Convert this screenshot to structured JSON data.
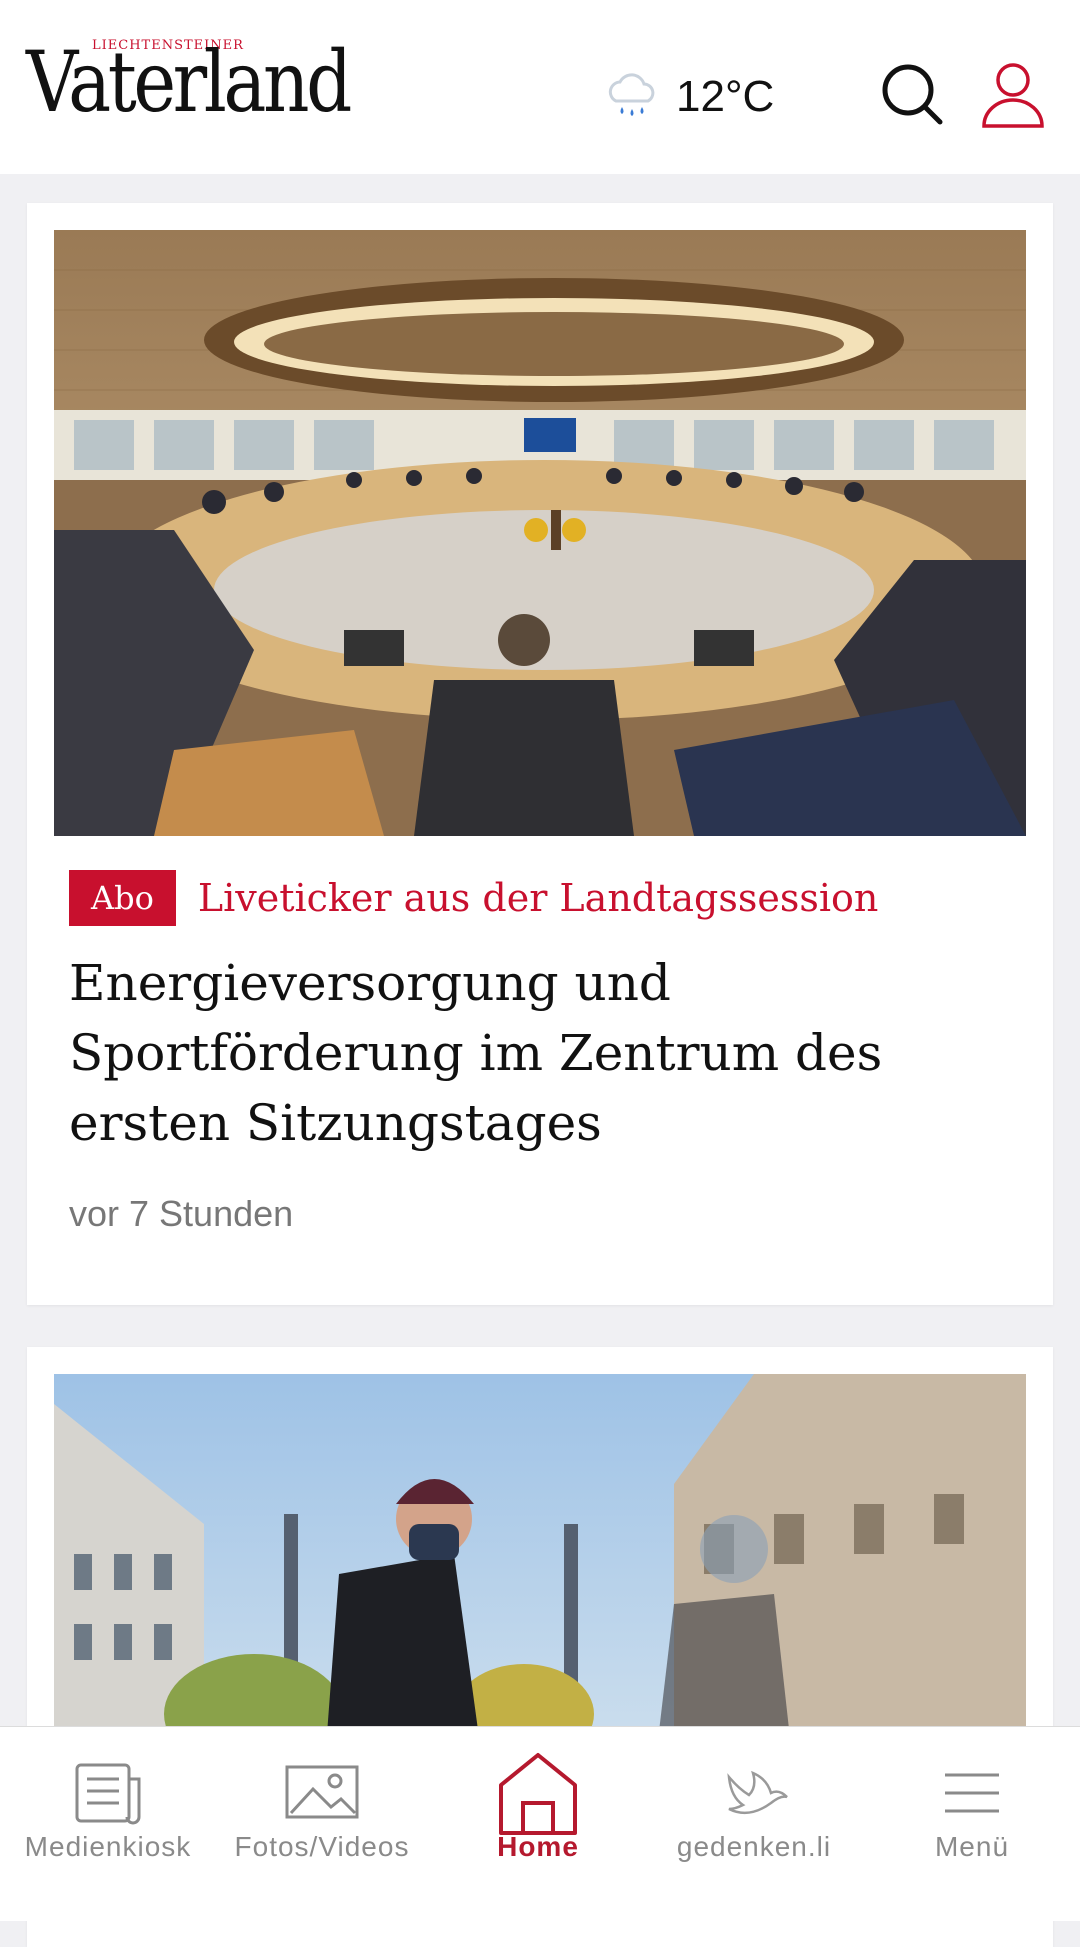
{
  "header": {
    "logo_small": "LIECHTENSTEINER",
    "logo_main": "Vaterland",
    "weather_icon": "rain-cloud-icon",
    "temperature": "12°C",
    "search_icon": "search-icon",
    "user_icon": "user-icon"
  },
  "articles": [
    {
      "image": "parliament-session-photo",
      "badge": "Abo",
      "kicker": "Liveticker aus der Landtagssession",
      "headline": "Energieversorgung und Sportförderung im Zentrum des ersten Sitzungstages",
      "time": "vor 7 Stunden"
    },
    {
      "image": "street-portrait-photo"
    }
  ],
  "tabbar": {
    "items": [
      {
        "label": "Medienkiosk",
        "icon": "newspaper-icon",
        "active": false
      },
      {
        "label": "Fotos/Videos",
        "icon": "photo-icon",
        "active": false
      },
      {
        "label": "Home",
        "icon": "home-icon",
        "active": true
      },
      {
        "label": "gedenken.li",
        "icon": "dove-icon",
        "active": false
      },
      {
        "label": "Menü",
        "icon": "menu-icon",
        "active": false
      }
    ]
  },
  "colors": {
    "brand_red": "#c8102e",
    "active_tab": "#b5192e",
    "text": "#111111",
    "muted": "#777777"
  }
}
